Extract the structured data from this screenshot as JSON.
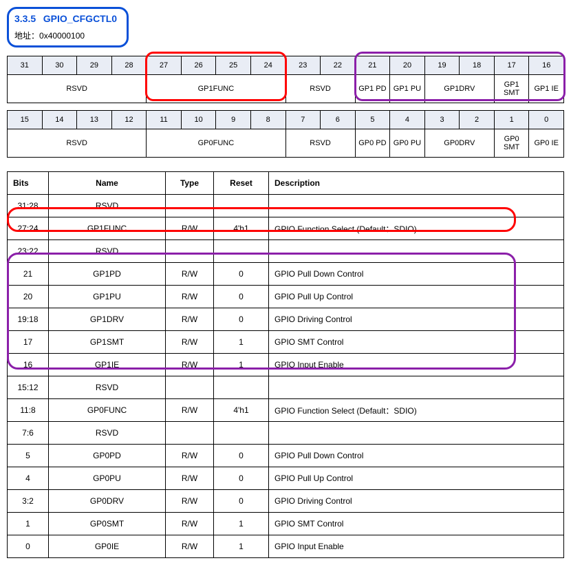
{
  "header": {
    "section_number": "3.3.5",
    "register_name": "GPIO_CFGCTL0",
    "addr_label": "地址：",
    "addr_value": "0x40000100"
  },
  "bit_layout": {
    "rows": [
      {
        "bit_nums": [
          "31",
          "30",
          "29",
          "28",
          "27",
          "26",
          "25",
          "24",
          "23",
          "22",
          "21",
          "20",
          "19",
          "18",
          "17",
          "16"
        ],
        "fields": [
          {
            "span": 4,
            "label": "RSVD"
          },
          {
            "span": 4,
            "label": "GP1FUNC"
          },
          {
            "span": 2,
            "label": "RSVD"
          },
          {
            "span": 1,
            "label": "GP1 PD"
          },
          {
            "span": 1,
            "label": "GP1 PU"
          },
          {
            "span": 2,
            "label": "GP1DRV"
          },
          {
            "span": 1,
            "label": "GP1 SMT"
          },
          {
            "span": 1,
            "label": "GP1 IE"
          }
        ]
      },
      {
        "bit_nums": [
          "15",
          "14",
          "13",
          "12",
          "11",
          "10",
          "9",
          "8",
          "7",
          "6",
          "5",
          "4",
          "3",
          "2",
          "1",
          "0"
        ],
        "fields": [
          {
            "span": 4,
            "label": "RSVD"
          },
          {
            "span": 4,
            "label": "GP0FUNC"
          },
          {
            "span": 2,
            "label": "RSVD"
          },
          {
            "span": 1,
            "label": "GP0 PD"
          },
          {
            "span": 1,
            "label": "GP0 PU"
          },
          {
            "span": 2,
            "label": "GP0DRV"
          },
          {
            "span": 1,
            "label": "GP0 SMT"
          },
          {
            "span": 1,
            "label": "GP0 IE"
          }
        ]
      }
    ]
  },
  "def_table": {
    "headers": {
      "bits": "Bits",
      "name": "Name",
      "type": "Type",
      "reset": "Reset",
      "desc": "Description"
    },
    "rows": [
      {
        "bits": "31:28",
        "name": "RSVD",
        "type": "",
        "reset": "",
        "desc": ""
      },
      {
        "bits": "27:24",
        "name": "GP1FUNC",
        "type": "R/W",
        "reset": "4'h1",
        "desc": "GPIO Function Select (Default：SDIO)"
      },
      {
        "bits": "23:22",
        "name": "RSVD",
        "type": "",
        "reset": "",
        "desc": ""
      },
      {
        "bits": "21",
        "name": "GP1PD",
        "type": "R/W",
        "reset": "0",
        "desc": "GPIO Pull Down Control"
      },
      {
        "bits": "20",
        "name": "GP1PU",
        "type": "R/W",
        "reset": "0",
        "desc": "GPIO Pull Up Control"
      },
      {
        "bits": "19:18",
        "name": "GP1DRV",
        "type": "R/W",
        "reset": "0",
        "desc": "GPIO Driving Control"
      },
      {
        "bits": "17",
        "name": "GP1SMT",
        "type": "R/W",
        "reset": "1",
        "desc": "GPIO SMT Control"
      },
      {
        "bits": "16",
        "name": "GP1IE",
        "type": "R/W",
        "reset": "1",
        "desc": "GPIO Input Enable"
      },
      {
        "bits": "15:12",
        "name": "RSVD",
        "type": "",
        "reset": "",
        "desc": ""
      },
      {
        "bits": "11:8",
        "name": "GP0FUNC",
        "type": "R/W",
        "reset": "4'h1",
        "desc": "GPIO Function Select (Default：SDIO)"
      },
      {
        "bits": "7:6",
        "name": "RSVD",
        "type": "",
        "reset": "",
        "desc": ""
      },
      {
        "bits": "5",
        "name": "GP0PD",
        "type": "R/W",
        "reset": "0",
        "desc": "GPIO Pull Down Control"
      },
      {
        "bits": "4",
        "name": "GP0PU",
        "type": "R/W",
        "reset": "0",
        "desc": "GPIO Pull Up Control"
      },
      {
        "bits": "3:2",
        "name": "GP0DRV",
        "type": "R/W",
        "reset": "0",
        "desc": "GPIO Driving Control"
      },
      {
        "bits": "1",
        "name": "GP0SMT",
        "type": "R/W",
        "reset": "1",
        "desc": "GPIO SMT Control"
      },
      {
        "bits": "0",
        "name": "GP0IE",
        "type": "R/W",
        "reset": "1",
        "desc": "GPIO Input Enable"
      }
    ]
  }
}
